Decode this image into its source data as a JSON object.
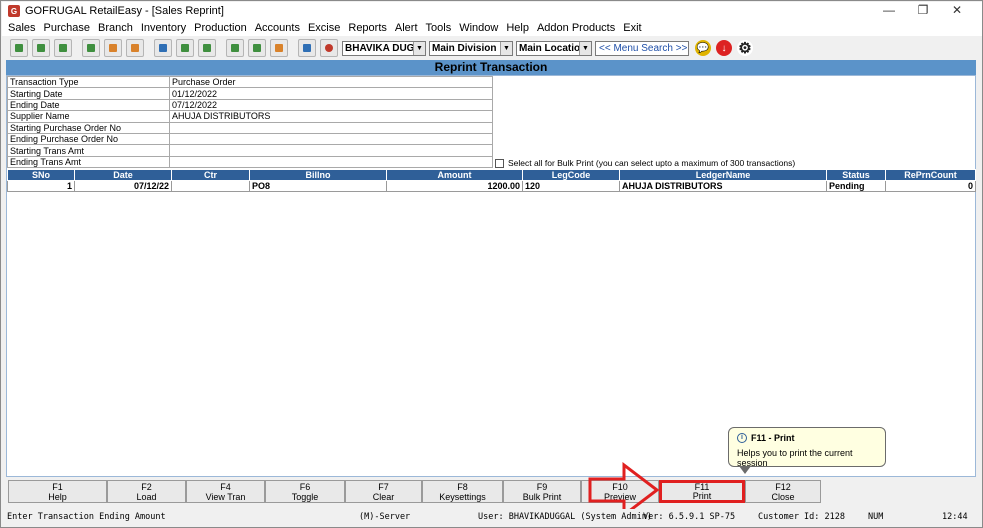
{
  "window": {
    "title": "GOFRUGAL RetailEasy - [Sales Reprint]",
    "controls": [
      "—",
      "❐",
      "✕"
    ]
  },
  "menu": [
    "Sales",
    "Purchase",
    "Branch",
    "Inventory",
    "Production",
    "Accounts",
    "Excise",
    "Reports",
    "Alert",
    "Tools",
    "Window",
    "Help",
    "Addon Products",
    "Exit"
  ],
  "toolbar": {
    "user_select": "BHAVIKA DUGG/",
    "division_select": "Main Division",
    "location_select": "Main Location",
    "menu_search_placeholder": "<< Menu Search >>",
    "icons": [
      "sales-icon",
      "purchase-icon",
      "return-icon",
      "stock-icon",
      "house-icon",
      "people-icon",
      "printer-icon",
      "transfer-icon",
      "transfer2-icon",
      "item-icon",
      "bag-icon",
      "tools-icon",
      "chart-icon",
      "power-icon"
    ]
  },
  "page": {
    "header": "Reprint Transaction"
  },
  "criteria": [
    {
      "label": "Transaction Type",
      "value": "Purchase Order"
    },
    {
      "label": "Starting Date",
      "value": "01/12/2022"
    },
    {
      "label": "Ending Date",
      "value": "07/12/2022"
    },
    {
      "label": "Supplier Name",
      "value": "AHUJA DISTRIBUTORS"
    },
    {
      "label": "Starting Purchase Order No",
      "value": ""
    },
    {
      "label": "Ending Purchase Order No",
      "value": ""
    },
    {
      "label": "Starting Trans Amt",
      "value": ""
    },
    {
      "label": "Ending Trans Amt",
      "value": ""
    }
  ],
  "bulk_print": {
    "label": "Select all for Bulk Print  (you can select upto a maximum of 300 transactions)"
  },
  "grid": {
    "columns": [
      "SNo",
      "Date",
      "Ctr",
      "Billno",
      "Amount",
      "LegCode",
      "LedgerName",
      "Status",
      "RePrnCount"
    ],
    "rows": [
      [
        "1",
        "07/12/22",
        "",
        "PO8",
        "1200.00",
        "120",
        "AHUJA DISTRIBUTORS",
        "Pending",
        "0"
      ]
    ]
  },
  "tooltip": {
    "title": "F11 - Print",
    "body": "Helps you to print the current session"
  },
  "function_keys": [
    {
      "key": "F1",
      "label": "Help"
    },
    {
      "key": "F2",
      "label": "Load"
    },
    {
      "key": "F4",
      "label": "View Tran"
    },
    {
      "key": "F6",
      "label": "Toggle"
    },
    {
      "key": "F7",
      "label": "Clear"
    },
    {
      "key": "F8",
      "label": "Keysettings"
    },
    {
      "key": "F9",
      "label": "Bulk Print"
    },
    {
      "key": "F10",
      "label": "Preview"
    },
    {
      "key": "F11",
      "label": "Print"
    },
    {
      "key": "F12",
      "label": "Close"
    }
  ],
  "status": {
    "message": "Enter Transaction Ending Amount",
    "server": "(M)-Server",
    "user": "User: BHAVIKADUGGAL (System Admin)",
    "version": "Ver: 6.5.9.1 SP-75",
    "customer": "Customer Id: 2128",
    "num": "NUM",
    "time": "12:44"
  },
  "colors": {
    "header_bg": "#5b93c9",
    "grid_header_bg": "#2f5f98",
    "highlight": "#e02020"
  }
}
